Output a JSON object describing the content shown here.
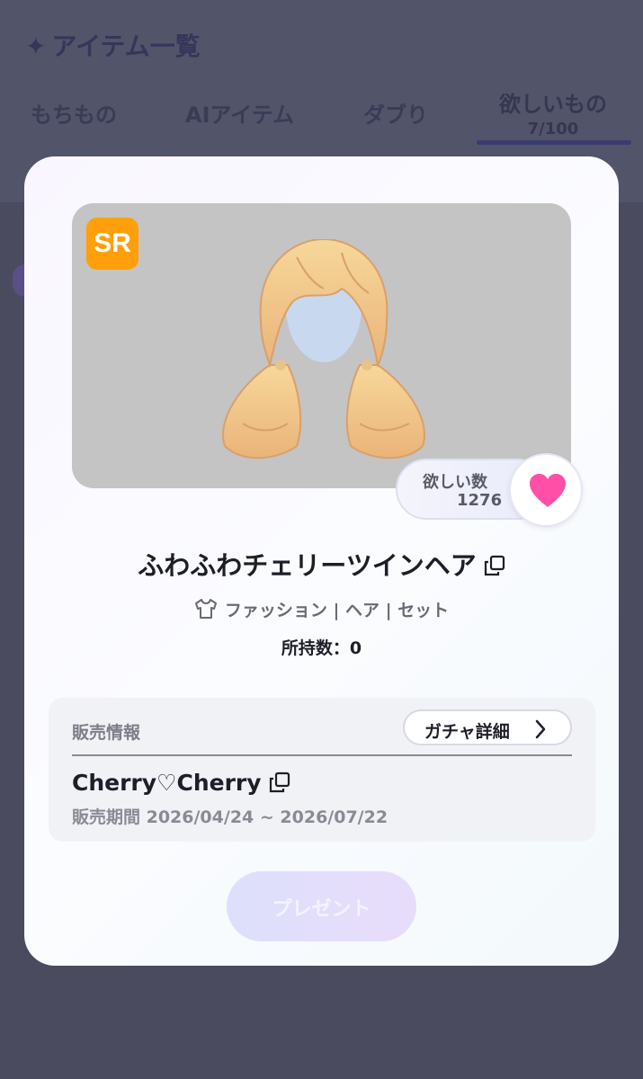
{
  "background": {
    "title": "アイテム一覧",
    "title_icon": "sparkle-icon",
    "tabs": [
      {
        "label": "もちもの"
      },
      {
        "label": "AIアイテム"
      },
      {
        "label": "ダブり"
      },
      {
        "label": "欲しいもの",
        "count": "7/100"
      }
    ]
  },
  "item": {
    "rarity": "SR",
    "name": "ふわふわチェリーツインヘア",
    "categories": "ファッション | ヘア | セット",
    "owned": "所持数：0",
    "want_label": "欲しい数",
    "want_count": "1276"
  },
  "sales": {
    "heading": "販売情報",
    "gacha_button": "ガチャ詳細",
    "gacha_name": "Cherry♡Cherry",
    "period": "販売期間 2026/04/24 ~ 2026/07/22"
  },
  "actions": {
    "present_label": "プレゼント"
  },
  "colors": {
    "overlay": "#4a4b5f",
    "rarity_badge": "#ff9f0a",
    "heart": "#ff4fa6",
    "preview_bg": "#c4c4c4"
  }
}
